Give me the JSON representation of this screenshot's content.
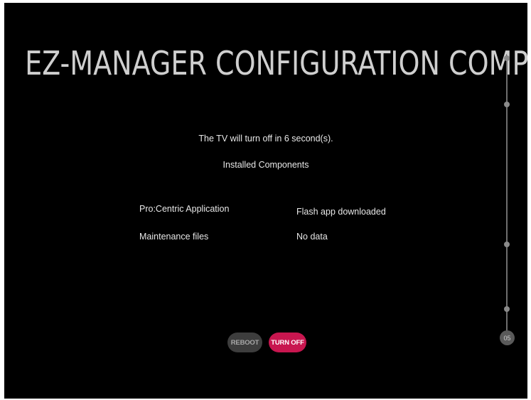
{
  "title": "EZ-MANAGER CONFIGURATION COMPLETE",
  "countdown_message": "The TV will turn off in 6 second(s).",
  "installed_heading": "Installed Components",
  "components": [
    {
      "name": "Pro:Centric Application",
      "status": "Flash app downloaded"
    },
    {
      "name": "Maintenance files",
      "status": "No data"
    }
  ],
  "buttons": {
    "reboot_label": "REBOOT",
    "turn_off_label": "TURN OFF"
  },
  "stepper": {
    "current_step": "05"
  },
  "colors": {
    "background": "#000000",
    "accent": "#c8164f",
    "secondary_button": "#3d3d3d"
  }
}
